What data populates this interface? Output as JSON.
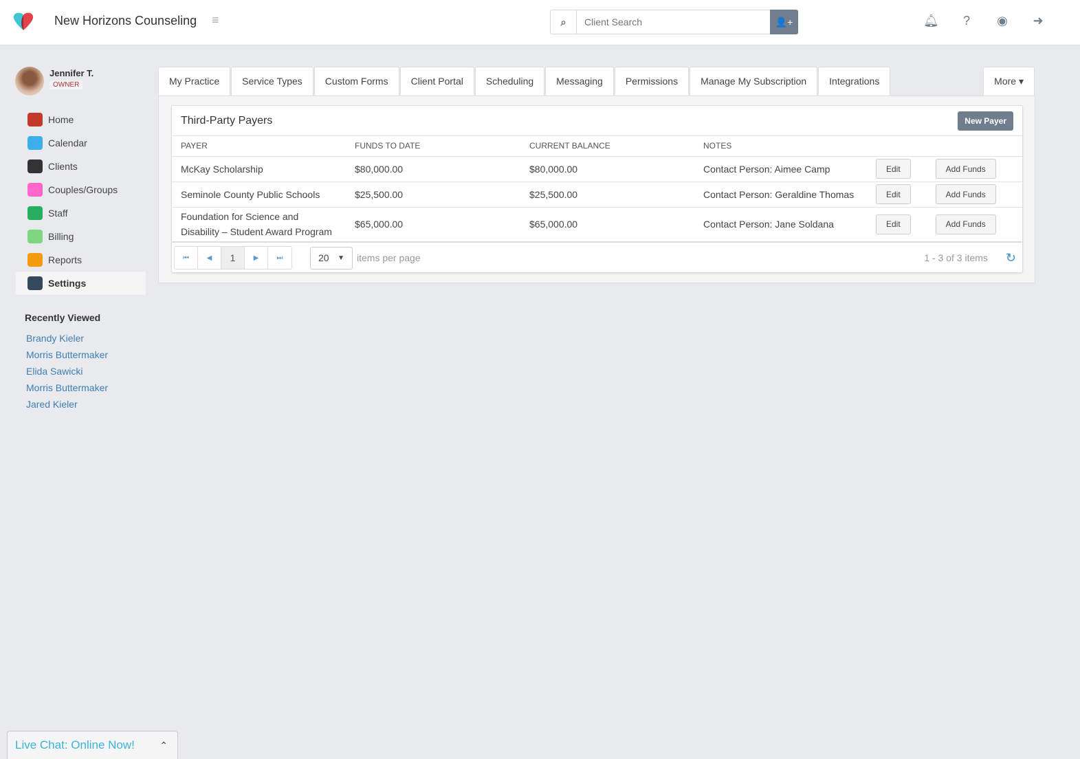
{
  "header": {
    "brand": "New Horizons Counseling",
    "search_placeholder": "Client Search"
  },
  "user": {
    "name": "Jennifer T.",
    "role": "OWNER"
  },
  "sidebar": {
    "items": [
      {
        "label": "Home",
        "icon": "home-icon",
        "color": "#c0392b"
      },
      {
        "label": "Calendar",
        "icon": "calendar-icon",
        "color": "#3daee9"
      },
      {
        "label": "Clients",
        "icon": "client-icon",
        "color": "#333333"
      },
      {
        "label": "Couples/Groups",
        "icon": "group-icon",
        "color": "#ff66cc"
      },
      {
        "label": "Staff",
        "icon": "staff-icon",
        "color": "#27ae60"
      },
      {
        "label": "Billing",
        "icon": "billing-icon",
        "color": "#7ed67e"
      },
      {
        "label": "Reports",
        "icon": "reports-icon",
        "color": "#f39c12"
      },
      {
        "label": "Settings",
        "icon": "settings-icon",
        "color": "#34495e",
        "active": true
      }
    ]
  },
  "recent": {
    "title": "Recently Viewed",
    "items": [
      "Brandy Kieler",
      "Morris Buttermaker",
      "Elida Sawicki",
      "Morris Buttermaker",
      "Jared Kieler"
    ]
  },
  "tabs": [
    "My Practice",
    "Service Types",
    "Custom Forms",
    "Client Portal",
    "Scheduling",
    "Messaging",
    "Permissions",
    "Manage My Subscription",
    "Integrations"
  ],
  "more_label": "More",
  "card": {
    "title": "Third-Party Payers",
    "new_label": "New Payer",
    "columns": [
      "PAYER",
      "FUNDS TO DATE",
      "CURRENT BALANCE",
      "NOTES"
    ],
    "rows": [
      {
        "payer": "McKay Scholarship",
        "funds": "$80,000.00",
        "balance": "$80,000.00",
        "notes": "Contact Person: Aimee Camp"
      },
      {
        "payer": "Seminole County Public Schools",
        "funds": "$25,500.00",
        "balance": "$25,500.00",
        "notes": "Contact Person: Geraldine Thomas"
      },
      {
        "payer": "Foundation for Science and Disability – Student Award Program",
        "funds": "$65,000.00",
        "balance": "$65,000.00",
        "notes": "Contact Person: Jane Soldana"
      }
    ],
    "edit_label": "Edit",
    "add_funds_label": "Add Funds"
  },
  "pager": {
    "page": "1",
    "page_size": "20",
    "per_page_label": "items per page",
    "info": "1 - 3 of 3 items"
  },
  "chat": {
    "label": "Live Chat: Online Now!"
  }
}
